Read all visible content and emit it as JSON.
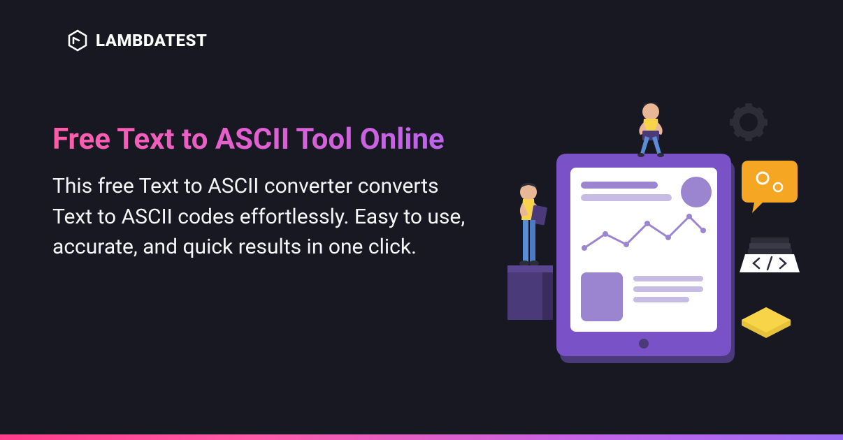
{
  "logo": {
    "text": "LAMBDATEST"
  },
  "hero": {
    "title": "Free Text to ASCII Tool Online",
    "description": "This free Text to ASCII converter converts Text to ASCII codes effortlessly. Easy to use, accurate, and quick results in one click."
  },
  "colors": {
    "background": "#181823",
    "gradient_start": "#ff5ca8",
    "gradient_end": "#b565ef",
    "purple": "#7a52c7",
    "purple_dark": "#4b3a7a",
    "orange": "#f5a623",
    "yellow": "#f8d548"
  }
}
